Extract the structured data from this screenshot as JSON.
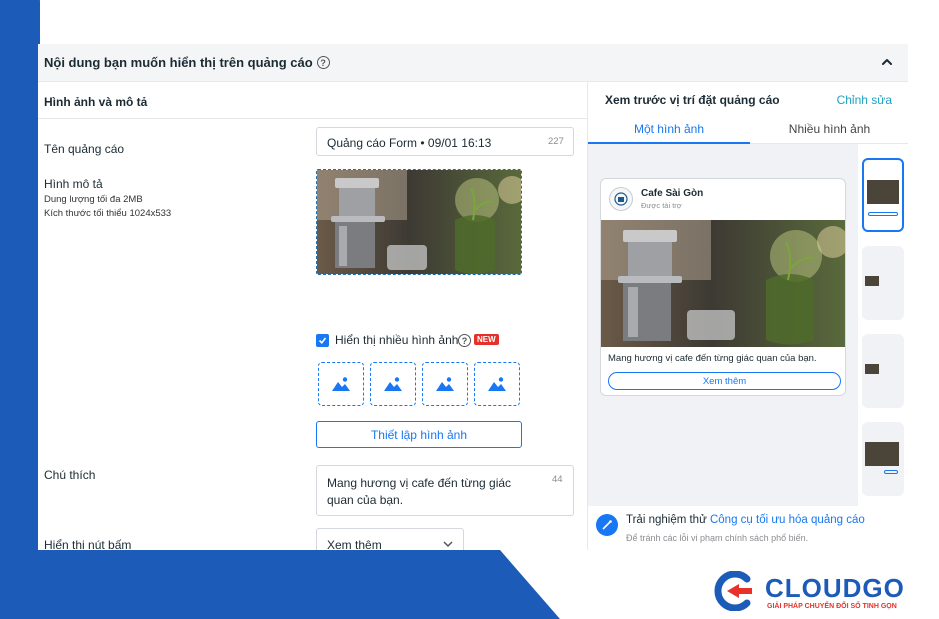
{
  "colors": {
    "accent": "#1877f2",
    "brand_blue": "#1d5bb8",
    "brand_red": "#e8312b",
    "new_badge": "#e4312b"
  },
  "panel": {
    "title": "Nội dung bạn muốn hiển thị trên quảng cáo",
    "collapse_icon": "chevron-up-icon"
  },
  "left": {
    "section_title": "Hình ảnh và mô tả",
    "ad_name": {
      "label": "Tên quảng cáo",
      "value": "Quảng cáo Form • 09/01 16:13",
      "counter": "227"
    },
    "image": {
      "label": "Hình mô tả",
      "hint_size": "Dung lượng tối đa 2MB",
      "hint_dims": "Kích thước tối thiểu 1024x533"
    },
    "multi_image": {
      "label": "Hiển thị nhiều hình ảnh",
      "badge": "NEW",
      "checked": true
    },
    "setup_button": "Thiết lập hình ảnh",
    "caption": {
      "label": "Chú thích",
      "value": "Mang hương vị cafe đến từng giác quan của bạn.",
      "counter": "44"
    },
    "cta": {
      "label": "Hiển thị nút bấm",
      "value": "Xem thêm"
    }
  },
  "right": {
    "title": "Xem trước vị trí đặt quảng cáo",
    "edit_link": "Chỉnh sửa",
    "tabs": [
      {
        "label": "Một hình ảnh",
        "active": true
      },
      {
        "label": "Nhiều hình ảnh",
        "active": false
      }
    ],
    "card": {
      "page_name": "Cafe Sài Gòn",
      "sponsored": "Được tài trợ",
      "caption": "Mang hương vị cafe đến từng giác quan của bạn.",
      "cta": "Xem thêm"
    },
    "tip": {
      "prefix": "Trải nghiệm thử ",
      "link": "Công cụ tối ưu hóa quảng cáo",
      "sub": "Để tránh các lỗi vi phạm chính sách phổ biến."
    }
  },
  "brand": {
    "name": "CLOUDGO",
    "tagline": "GIẢI PHÁP CHUYỂN ĐỔI SỐ TINH GỌN"
  }
}
